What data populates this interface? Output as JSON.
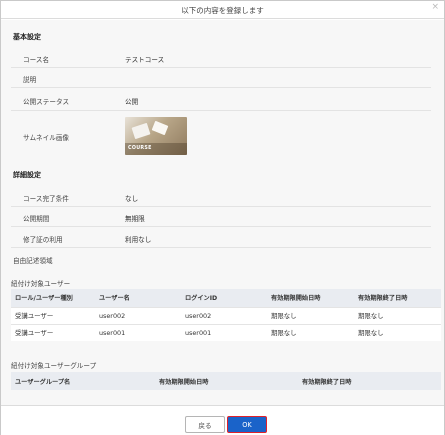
{
  "dialog": {
    "title": "以下の内容を登録します",
    "close_glyph": "×"
  },
  "basic": {
    "heading": "基本設定",
    "fields": [
      {
        "label": "コース名",
        "value": "テストコース"
      },
      {
        "label": "説明",
        "value": ""
      },
      {
        "label": "公開ステータス",
        "value": "公開"
      },
      {
        "label": "サムネイル画像",
        "value": ""
      }
    ],
    "thumbnail_caption": "COURSE"
  },
  "detail": {
    "heading": "詳細設定",
    "fields": [
      {
        "label": "コース完了条件",
        "value": "なし"
      },
      {
        "label": "公開期間",
        "value": "無期限"
      },
      {
        "label": "修了証の利用",
        "value": "利用なし"
      },
      {
        "label": "自由記述領域",
        "value": ""
      }
    ]
  },
  "user_table": {
    "title": "紐付け対象ユーザー",
    "headers": [
      "ロール/ユーザー種別",
      "ユーザー名",
      "ログインID",
      "有効期限開始日時",
      "有効期限終了日時"
    ],
    "rows": [
      [
        "受講ユーザー",
        "user002",
        "user002",
        "期限なし",
        "期限なし"
      ],
      [
        "受講ユーザー",
        "user001",
        "user001",
        "期限なし",
        "期限なし"
      ]
    ]
  },
  "group_table": {
    "title": "紐付け対象ユーザーグループ",
    "headers": [
      "ユーザーグループ名",
      "有効期限開始日時",
      "有効期限終了日時"
    ]
  },
  "footer": {
    "back_label": "戻る",
    "ok_label": "OK"
  },
  "colors": {
    "primary": "#1a63c9",
    "focus_outline": "#e0212b",
    "table_header_bg": "#e9ecf1"
  }
}
